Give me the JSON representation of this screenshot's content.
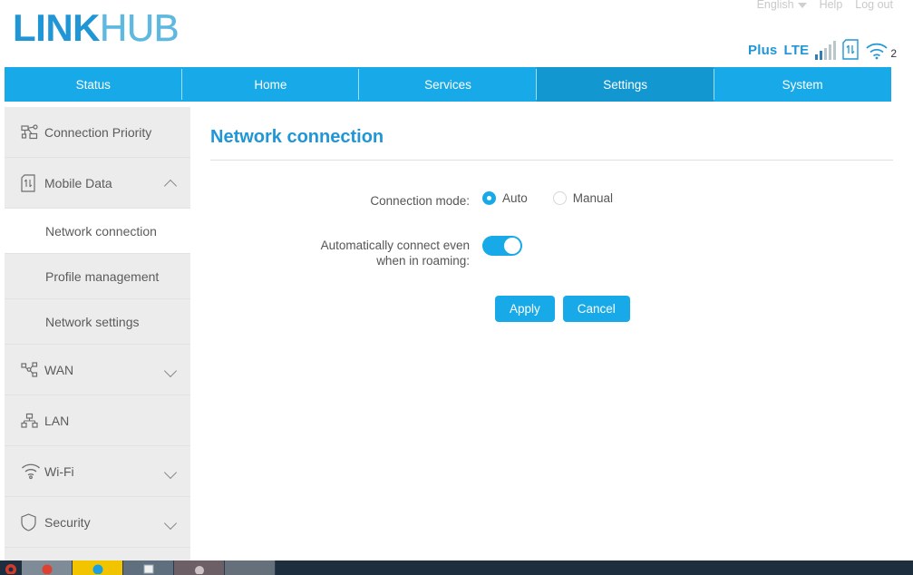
{
  "brand": {
    "primary": "LINK",
    "secondary": "HUB"
  },
  "utility": {
    "language": "English",
    "help": "Help",
    "logout": "Log out"
  },
  "status": {
    "carrier": "Plus",
    "network_type": "LTE",
    "signal_bars_total": 5,
    "signal_bars_active": 2,
    "sim_icon": "sim-card-icon",
    "wifi_icon": "wifi-icon",
    "wifi_client_count": "2"
  },
  "nav": {
    "tabs": [
      {
        "label": "Status",
        "active": false
      },
      {
        "label": "Home",
        "active": false
      },
      {
        "label": "Services",
        "active": false
      },
      {
        "label": "Settings",
        "active": true
      },
      {
        "label": "System",
        "active": false
      }
    ]
  },
  "sidebar": {
    "items": [
      {
        "label": "Connection Priority",
        "icon": "network-topology-icon",
        "chevron": "none"
      },
      {
        "label": "Mobile Data",
        "icon": "sim-card-icon",
        "chevron": "up"
      },
      {
        "label": "WAN",
        "icon": "share-nodes-icon",
        "chevron": "down"
      },
      {
        "label": "LAN",
        "icon": "lan-tree-icon",
        "chevron": "none"
      },
      {
        "label": "Wi-Fi",
        "icon": "wifi-icon",
        "chevron": "down"
      },
      {
        "label": "Security",
        "icon": "shield-icon",
        "chevron": "down"
      }
    ],
    "mobile_data_subitems": [
      {
        "label": "Network connection",
        "active": true
      },
      {
        "label": "Profile management",
        "active": false
      },
      {
        "label": "Network settings",
        "active": false
      }
    ]
  },
  "main": {
    "title": "Network connection",
    "connection_mode": {
      "label": "Connection mode:",
      "options": [
        {
          "label": "Auto",
          "selected": true
        },
        {
          "label": "Manual",
          "selected": false
        }
      ]
    },
    "roaming": {
      "label_line1": "Automatically connect even",
      "label_line2": "when in roaming:",
      "enabled": true
    },
    "apply_label": "Apply",
    "cancel_label": "Cancel"
  },
  "colors": {
    "accent": "#17a9e8",
    "accent_dark": "#1297d1",
    "brand_blue": "#2196d6",
    "sidebar_bg": "#ececec"
  }
}
